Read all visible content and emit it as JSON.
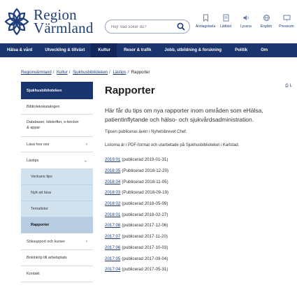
{
  "logo": {
    "line1": "Region",
    "line2": "Värmland"
  },
  "search": {
    "placeholder": "Hej! Vad söker du?"
  },
  "tools": [
    {
      "icon": "bookmark-icon",
      "label": "Anslagstavla"
    },
    {
      "icon": "document-icon",
      "label": "Lättläst"
    },
    {
      "icon": "speaker-icon",
      "label": "Lyssna"
    },
    {
      "icon": "globe-icon",
      "label": "English"
    },
    {
      "icon": "presentation-icon",
      "label": "Pressrum"
    }
  ],
  "nav": [
    {
      "label": "Hälsa & vård",
      "active": false
    },
    {
      "label": "Utveckling & tillväxt",
      "active": false
    },
    {
      "label": "Kultur",
      "active": true
    },
    {
      "label": "Resor & trafik",
      "active": false
    },
    {
      "label": "Jobb, utbildning & forskning",
      "active": false
    },
    {
      "label": "Politik",
      "active": false
    },
    {
      "label": "Om",
      "active": false
    }
  ],
  "breadcrumb": {
    "items": [
      "Regionvärmland",
      "Kultur",
      "Sjukhusbiblioteken",
      "Lästips"
    ],
    "current": "Rapporter"
  },
  "sidebar": [
    {
      "label": "Sjukhusbiblioteken",
      "type": "top",
      "chevron": ""
    },
    {
      "label": "Bibliotekskatalogen",
      "type": "normal",
      "chevron": ""
    },
    {
      "label": "Databaser, tidskrifter, e-böcker & appar",
      "type": "normal",
      "chevron": ""
    },
    {
      "label": "Läsa hos oss",
      "type": "normal",
      "chevron": "›"
    },
    {
      "label": "Lästips",
      "type": "normal",
      "chevron": "⌄"
    },
    {
      "label": "Veckans tips",
      "type": "sub",
      "chevron": ""
    },
    {
      "label": "Nytt att läsa",
      "type": "sub",
      "chevron": ""
    },
    {
      "label": "Temalistor",
      "type": "sub",
      "chevron": ""
    },
    {
      "label": "Rapporter",
      "type": "current",
      "chevron": ""
    },
    {
      "label": "Söksupport och kurser",
      "type": "normal",
      "chevron": "›"
    },
    {
      "label": "Boklnköp till arbetsplats",
      "type": "normal",
      "chevron": ""
    },
    {
      "label": "Kontakt",
      "type": "normal",
      "chevron": ""
    }
  ],
  "main": {
    "title": "Rapporter",
    "print_label": "⎙ L",
    "intro": "Här får du tips om nya rapporter inom områden som eHälsa, patientinflytande och hälso- och sjukvårdsadministration.",
    "p1": "Tipsen publiceras även i Nyhetsbrevet Chef.",
    "p2": "Listorna är i PDF-format och utarbetade på Sjukhusbiblioteket i Karlstad.",
    "reports": [
      {
        "link": "2019:01",
        "date": "(publicerad 2019-01-31)"
      },
      {
        "link": "2018:05",
        "date": "(Publicerad 2018-12-20)"
      },
      {
        "link": "2018:04",
        "date": "(Publicerad 2018-11-05)"
      },
      {
        "link": "2018:03",
        "date": "(Publicerad 2018-09-19)"
      },
      {
        "link": "2018:02",
        "date": "(publicerad 2018-05-09)"
      },
      {
        "link": "2018:01",
        "date": "(publicerad 2018-02-27)"
      },
      {
        "link": "2017:08",
        "date": "(publicerad 2017-12-06)"
      },
      {
        "link": "2017:07",
        "date": "(publicerad 2017-11-20)"
      },
      {
        "link": "2017:06",
        "date": "(publicerad 2017-10-03)"
      },
      {
        "link": "2017:05",
        "date": "(publicerad 2017-09-04)"
      },
      {
        "link": "2017:04",
        "date": "(publicerad 2017-05-31)"
      }
    ]
  },
  "colors": {
    "brand": "#1a356d",
    "sidebar_sub": "#d2e1ee",
    "link": "#1d3c78"
  }
}
